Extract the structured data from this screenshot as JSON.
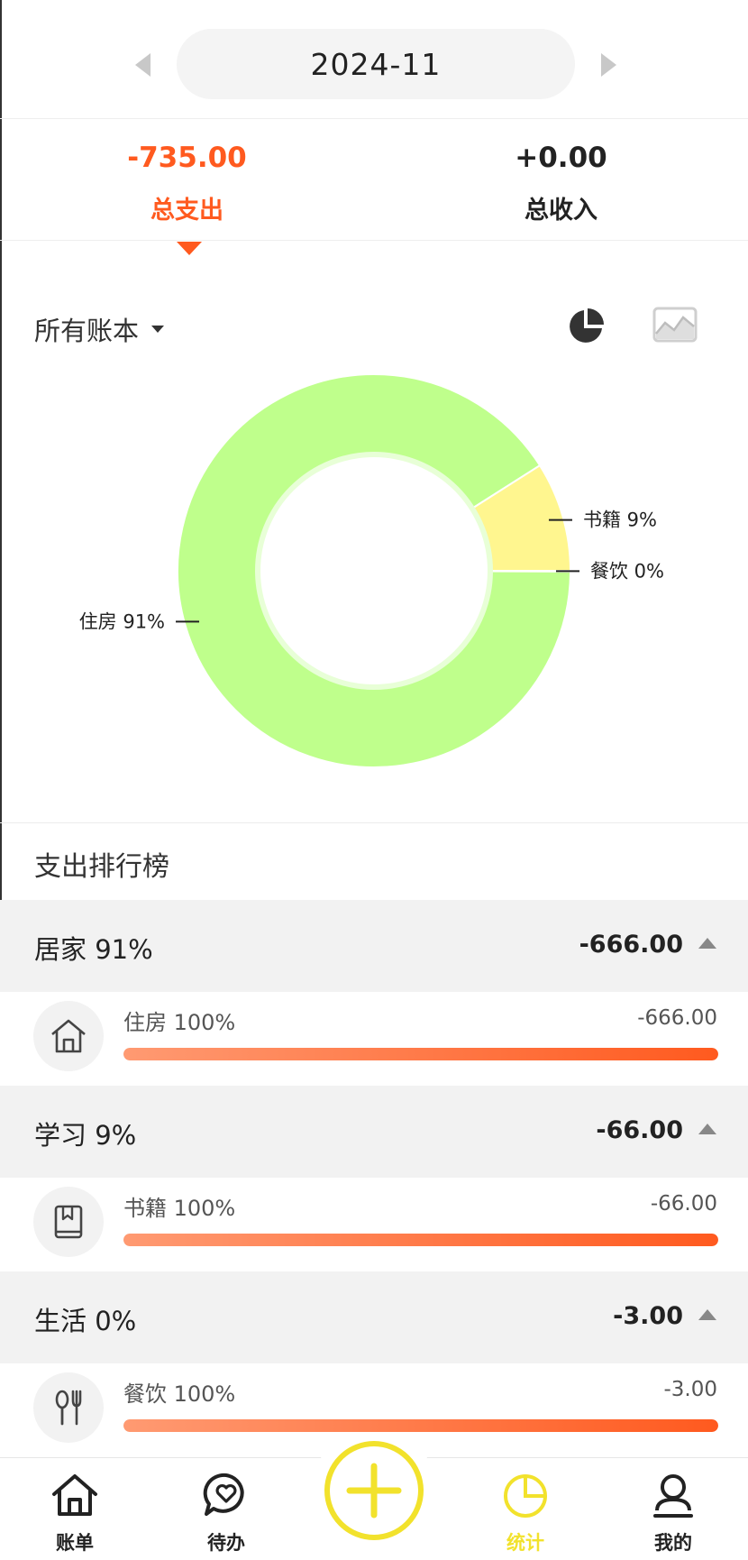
{
  "header": {
    "month": "2024-11",
    "prev_icon": "chevron-left-icon",
    "next_icon": "chevron-right-icon"
  },
  "summary": {
    "expense_value": "-735.00",
    "expense_label": "总支出",
    "income_value": "+0.00",
    "income_label": "总收入",
    "active": "expense"
  },
  "book_selector": {
    "label": "所有账本"
  },
  "view_toggles": {
    "pie_icon": "pie-chart-icon",
    "line_icon": "line-chart-icon",
    "active": "pie"
  },
  "chart_data": {
    "type": "pie",
    "donut": true,
    "slices": [
      {
        "label": "住房 91%",
        "value": 91,
        "color": "#bfff8c"
      },
      {
        "label": "书籍 9%",
        "value": 9,
        "color": "#fff68f"
      },
      {
        "label": "餐饮 0%",
        "value": 0,
        "color": "#ffb36b"
      }
    ]
  },
  "ranking": {
    "title": "支出排行榜",
    "groups": [
      {
        "name": "居家 91%",
        "amount": "-666.00",
        "items": [
          {
            "name": "住房 100%",
            "amount": "-666.00",
            "progress": 100,
            "icon": "house-icon"
          }
        ]
      },
      {
        "name": "学习 9%",
        "amount": "-66.00",
        "items": [
          {
            "name": "书籍 100%",
            "amount": "-66.00",
            "progress": 100,
            "icon": "book-icon"
          }
        ]
      },
      {
        "name": "生活 0%",
        "amount": "-3.00",
        "items": [
          {
            "name": "餐饮 100%",
            "amount": "-3.00",
            "progress": 100,
            "icon": "utensils-icon"
          }
        ]
      }
    ]
  },
  "nav": {
    "items": [
      {
        "label": "账单",
        "icon": "house-icon"
      },
      {
        "label": "待办",
        "icon": "heart-chat-icon"
      },
      {
        "label": "统计",
        "icon": "pie-chart-icon",
        "active": true
      },
      {
        "label": "我的",
        "icon": "user-icon"
      }
    ],
    "fab_icon": "plus-icon",
    "accent": "#f2e22c"
  },
  "colors": {
    "expense": "#ff5a1f",
    "accent": "#f2e22c"
  }
}
